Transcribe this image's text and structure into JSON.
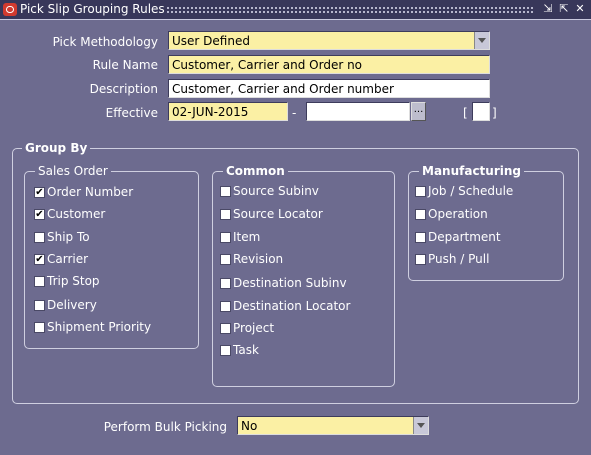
{
  "window": {
    "title": "Pick Slip Grouping Rules",
    "controls": {
      "minimize": "⇲",
      "maximize": "⇱",
      "close": "✕"
    }
  },
  "form": {
    "pick_methodology": {
      "label": "Pick Methodology",
      "value": "User Defined"
    },
    "rule_name": {
      "label": "Rule Name",
      "value": "Customer, Carrier and Order no"
    },
    "description": {
      "label": "Description",
      "value": "Customer, Carrier and Order number"
    },
    "effective": {
      "label": "Effective",
      "from": "02-JUN-2015",
      "to": "",
      "separator": "-",
      "lov_label": "...",
      "open_bracket": "[",
      "close_bracket": "]"
    }
  },
  "group_by": {
    "title": "Group By",
    "sales_order": {
      "title": "Sales Order",
      "items": [
        {
          "label": "Order Number",
          "checked": true,
          "mark": "✔"
        },
        {
          "label": "Customer",
          "checked": true,
          "mark": "✔"
        },
        {
          "label": "Ship To",
          "checked": false,
          "mark": ""
        },
        {
          "label": "Carrier",
          "checked": true,
          "mark": "✔"
        },
        {
          "label": "Trip Stop",
          "checked": false,
          "mark": ""
        },
        {
          "label": "Delivery",
          "checked": false,
          "mark": ""
        },
        {
          "label": "Shipment Priority",
          "checked": false,
          "mark": ""
        }
      ]
    },
    "common": {
      "title": "Common",
      "items": [
        {
          "label": "Source Subinv",
          "checked": false,
          "mark": ""
        },
        {
          "label": "Source Locator",
          "checked": false,
          "mark": ""
        },
        {
          "label": "Item",
          "checked": false,
          "mark": ""
        },
        {
          "label": "Revision",
          "checked": false,
          "mark": ""
        },
        {
          "label": "Destination Subinv",
          "checked": false,
          "mark": ""
        },
        {
          "label": "Destination Locator",
          "checked": false,
          "mark": ""
        },
        {
          "label": "Project",
          "checked": false,
          "mark": ""
        },
        {
          "label": "Task",
          "checked": false,
          "mark": ""
        }
      ]
    },
    "manufacturing": {
      "title": "Manufacturing",
      "items": [
        {
          "label": "Job / Schedule",
          "checked": false,
          "mark": ""
        },
        {
          "label": "Operation",
          "checked": false,
          "mark": ""
        },
        {
          "label": "Department",
          "checked": false,
          "mark": ""
        },
        {
          "label": "Push / Pull",
          "checked": false,
          "mark": ""
        }
      ]
    }
  },
  "bulk_picking": {
    "label": "Perform Bulk Picking",
    "value": "No"
  },
  "colors": {
    "background": "#6d6b8f",
    "titlebar": "#38375a",
    "required_field": "#fbf0a4",
    "optional_field": "#ffffff"
  }
}
